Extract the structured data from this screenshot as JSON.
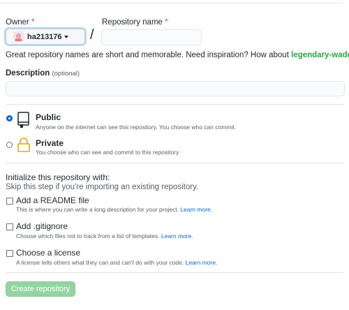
{
  "owner": {
    "label": "Owner",
    "required_mark": "*",
    "value": "ha213176"
  },
  "repo_name": {
    "label": "Repository name",
    "required_mark": "*",
    "value": ""
  },
  "separator": "/",
  "hint": {
    "text": "Great repository names are short and memorable. Need inspiration? How about ",
    "suggestion": "legendary-waddle",
    "end": "?"
  },
  "description": {
    "label": "Description",
    "optional": "(optional)",
    "value": ""
  },
  "visibility": {
    "selected": "public",
    "public": {
      "title": "Public",
      "desc": "Anyone on the internet can see this repository. You choose who can commit."
    },
    "private": {
      "title": "Private",
      "desc": "You choose who can see and commit to this repository."
    }
  },
  "init": {
    "title": "Initialize this repository with:",
    "subtitle": "Skip this step if you're importing an existing repository.",
    "readme": {
      "title": "Add a README file",
      "desc": "This is where you can write a long description for your project. ",
      "link": "Learn more."
    },
    "gitignore": {
      "title": "Add .gitignore",
      "desc": "Choose which files not to track from a list of templates. ",
      "link": "Learn more."
    },
    "license": {
      "title": "Choose a license",
      "desc": "A license tells others what they can and can't do with your code. ",
      "link": "Learn more."
    }
  },
  "submit": {
    "label": "Create repository",
    "enabled": false
  },
  "colors": {
    "accent": "#0366d6",
    "success": "#28a745",
    "button_disabled": "#94d3a2",
    "required": "#d73a49"
  }
}
